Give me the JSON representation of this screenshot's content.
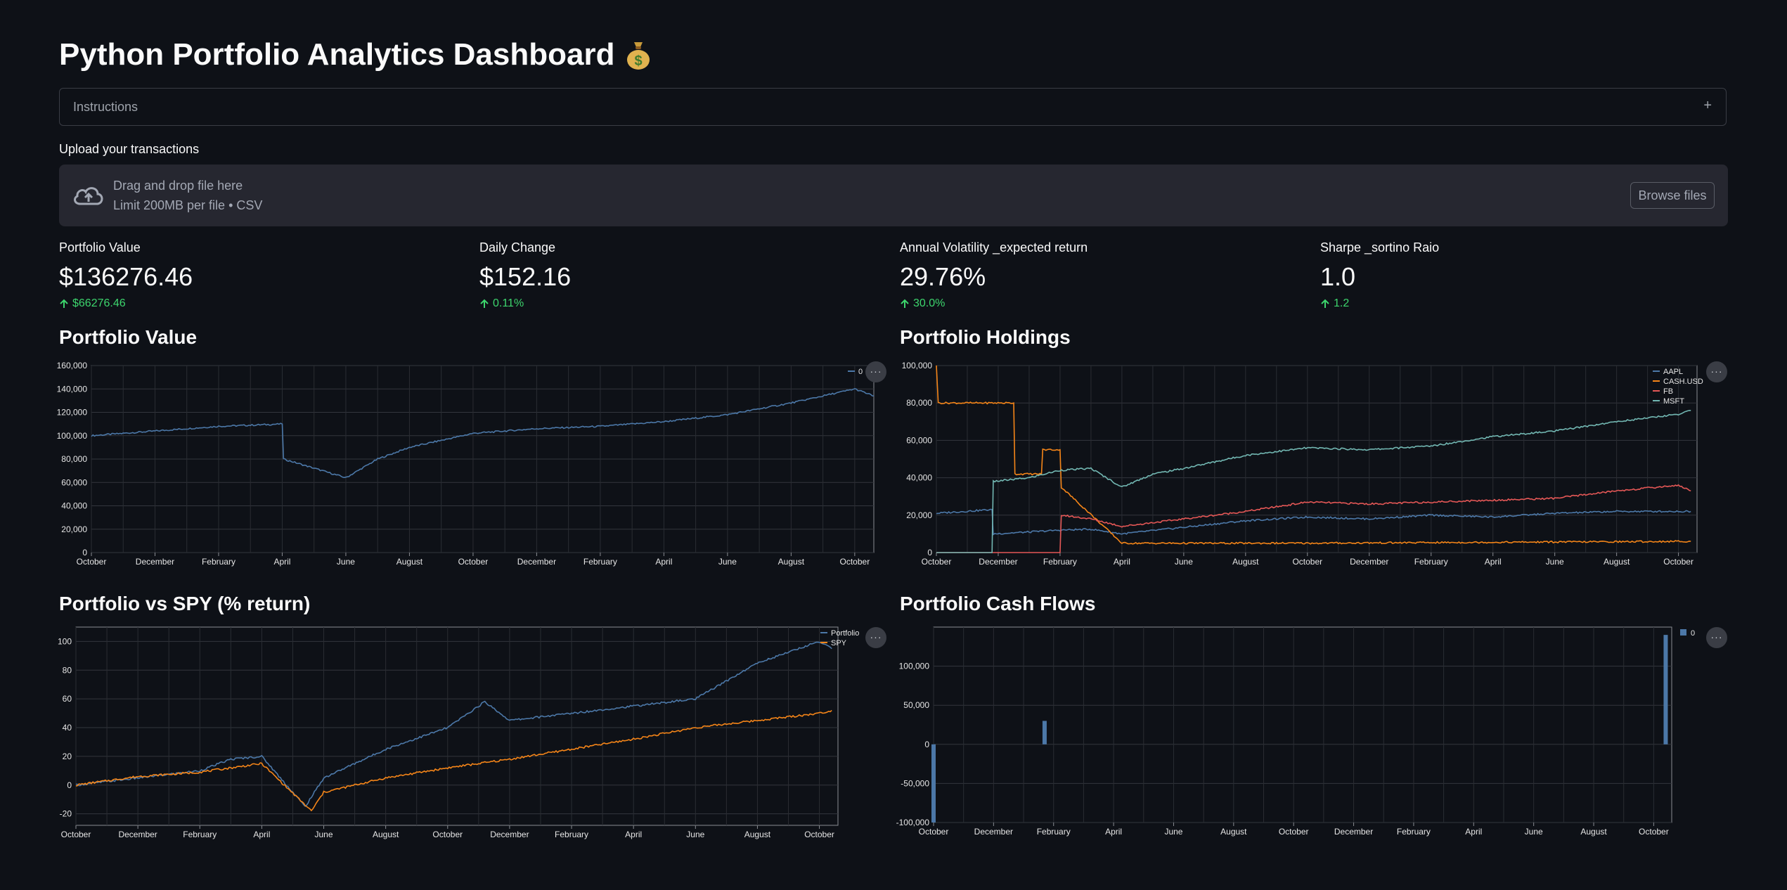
{
  "app": {
    "title": "Python Portfolio Analytics Dashboard",
    "expander_label": "Instructions",
    "expander_icon": "plus-icon",
    "upload_label": "Upload your transactions",
    "dropzone_line1": "Drag and drop file here",
    "dropzone_line2": "Limit 200MB per file • CSV",
    "browse_button": "Browse files",
    "accent_up": "#3dd56d",
    "background": "#0e1117"
  },
  "metrics": [
    {
      "label": "Portfolio Value",
      "value": "$136276.46",
      "delta": "$66276.46"
    },
    {
      "label": "Daily Change",
      "value": "$152.16",
      "delta": "0.11%"
    },
    {
      "label": "Annual Volatility _expected return",
      "value": "29.76%",
      "delta": "30.0%"
    },
    {
      "label": "Sharpe _sortino Raio",
      "value": "1.0",
      "delta": "1.2"
    }
  ],
  "sections": {
    "value": "Portfolio Value",
    "holdings": "Portfolio Holdings",
    "vs_spy": "Portfolio vs SPY (% return)",
    "cash": "Portfolio Cash Flows"
  },
  "menu_label": "···",
  "chart_data": [
    {
      "type": "line",
      "title": "Portfolio Value",
      "x_months": [
        "October",
        "December",
        "February",
        "April",
        "June",
        "August",
        "October",
        "December",
        "February",
        "April",
        "June",
        "August",
        "October"
      ],
      "ylim": [
        0,
        160000
      ],
      "yticks": [
        "0",
        "20,000",
        "40,000",
        "60,000",
        "80,000",
        "100,000",
        "120,000",
        "140,000",
        "160,000"
      ],
      "grid": true,
      "legend_position": "top-right",
      "series": [
        {
          "name": "0",
          "color": "#4c78a8",
          "x": [
            0,
            1,
            2,
            3,
            3.02,
            4,
            4.5,
            5,
            6,
            7,
            8,
            9,
            10,
            11,
            12,
            12.3
          ],
          "values": [
            100000,
            104000,
            108000,
            110000,
            80000,
            64000,
            80000,
            90000,
            102000,
            106000,
            108000,
            112000,
            118000,
            128000,
            140000,
            134000
          ]
        }
      ]
    },
    {
      "type": "line",
      "title": "Portfolio Holdings",
      "x_months": [
        "October",
        "December",
        "February",
        "April",
        "June",
        "August",
        "October",
        "December",
        "February",
        "April",
        "June",
        "August",
        "October"
      ],
      "ylim": [
        0,
        100000
      ],
      "yticks": [
        "0",
        "20,000",
        "40,000",
        "60,000",
        "80,000",
        "100,000"
      ],
      "grid": true,
      "legend_position": "top-right",
      "series": [
        {
          "name": "AAPL",
          "color": "#4c78a8",
          "x": [
            0,
            0.9,
            0.92,
            1.5,
            2,
            2.5,
            3,
            4,
            5,
            6,
            7,
            8,
            9,
            10,
            11,
            12.2
          ],
          "values": [
            21000,
            23000,
            10000,
            11000,
            12000,
            12500,
            10000,
            13500,
            17000,
            19000,
            18000,
            20000,
            19000,
            21000,
            22000,
            22000
          ]
        },
        {
          "name": "CASH.USD",
          "color": "#f58518",
          "x": [
            0,
            0.03,
            0.6,
            0.62,
            1.25,
            1.27,
            1.7,
            1.72,
            2.0,
            2.02,
            3,
            6,
            9,
            12.2
          ],
          "values": [
            100000,
            80000,
            80000,
            80000,
            80000,
            42000,
            42000,
            55000,
            55000,
            35000,
            5000,
            5000,
            5500,
            6000
          ]
        },
        {
          "name": "FB",
          "color": "#e45756",
          "x": [
            0,
            2.0,
            2.02,
            2.5,
            3,
            4,
            5,
            6,
            7,
            8,
            9,
            10,
            11,
            12,
            12.2
          ],
          "values": [
            0,
            0,
            20000,
            18000,
            14000,
            18000,
            22000,
            27000,
            26000,
            27000,
            28000,
            29000,
            33000,
            36000,
            33000
          ]
        },
        {
          "name": "MSFT",
          "color": "#72b7b2",
          "x": [
            0,
            0.9,
            0.92,
            1.5,
            2,
            2.5,
            3,
            3.5,
            4,
            5,
            6,
            7,
            8,
            9,
            10,
            11,
            12,
            12.2
          ],
          "values": [
            0,
            0,
            38000,
            40000,
            44000,
            45000,
            35000,
            42000,
            45000,
            52000,
            56000,
            55000,
            57000,
            62000,
            65000,
            70000,
            74000,
            76000
          ]
        }
      ]
    },
    {
      "type": "line",
      "title": "Portfolio vs SPY (% return)",
      "x_months": [
        "October",
        "December",
        "February",
        "April",
        "June",
        "August",
        "October",
        "December",
        "February",
        "April",
        "June",
        "August",
        "October"
      ],
      "ylim": [
        -28,
        110
      ],
      "yticks": [
        "-20",
        "0",
        "20",
        "40",
        "60",
        "80",
        "100"
      ],
      "grid": true,
      "legend_position": "top-right",
      "series": [
        {
          "name": "Portfolio",
          "color": "#4c78a8",
          "x": [
            0,
            1,
            2,
            2.5,
            3,
            3.7,
            4,
            5,
            6,
            6.6,
            7,
            8,
            9,
            10,
            11,
            12,
            12.2
          ],
          "values": [
            0,
            5,
            10,
            18,
            20,
            -15,
            5,
            25,
            40,
            58,
            45,
            50,
            55,
            60,
            85,
            100,
            95
          ]
        },
        {
          "name": "SPY",
          "color": "#f58518",
          "x": [
            0,
            1,
            2,
            2.5,
            3,
            3.8,
            4,
            5,
            6,
            7,
            8,
            9,
            10,
            11,
            12,
            12.2
          ],
          "values": [
            0,
            6,
            9,
            12,
            15,
            -18,
            -5,
            5,
            12,
            18,
            25,
            32,
            40,
            45,
            50,
            52
          ]
        }
      ]
    },
    {
      "type": "bar",
      "title": "Portfolio Cash Flows",
      "x_months": [
        "October",
        "December",
        "February",
        "April",
        "June",
        "August",
        "October",
        "December",
        "February",
        "April",
        "June",
        "August",
        "October"
      ],
      "ylim": [
        -100000,
        150000
      ],
      "yticks": [
        "-100,000",
        "-50,000",
        "0",
        "50,000",
        "100,000"
      ],
      "grid": true,
      "legend_position": "top-right",
      "series": [
        {
          "name": "0",
          "color": "#4c78a8",
          "x": [
            0,
            1.85,
            12.2
          ],
          "values": [
            -100000,
            30000,
            140000
          ]
        }
      ]
    }
  ]
}
